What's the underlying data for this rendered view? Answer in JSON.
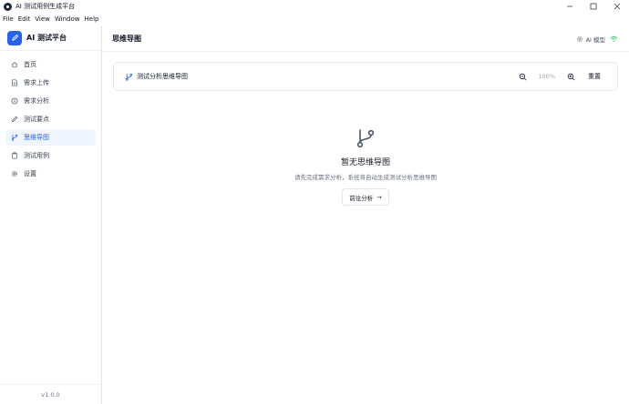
{
  "window": {
    "title": "AI 测试用例生成平台"
  },
  "menu": [
    "File",
    "Edit",
    "View",
    "Window",
    "Help"
  ],
  "brand": {
    "name": "AI 测试平台"
  },
  "sidebar": {
    "items": [
      {
        "label": "首页",
        "icon": "home-icon",
        "active": false
      },
      {
        "label": "需求上传",
        "icon": "file-text-icon",
        "active": false
      },
      {
        "label": "需求分析",
        "icon": "analysis-icon",
        "active": false
      },
      {
        "label": "测试要点",
        "icon": "pencil-icon",
        "active": false
      },
      {
        "label": "思维导图",
        "icon": "git-branch-icon",
        "active": true
      },
      {
        "label": "测试用例",
        "icon": "clipboard-icon",
        "active": false
      },
      {
        "label": "设置",
        "icon": "gear-icon",
        "active": false
      }
    ],
    "version": "v1.0.0"
  },
  "header": {
    "title": "思维导图",
    "model_label": "AI 模型",
    "status_color": "#22c55e"
  },
  "toolbar": {
    "title": "测试分析思维导图",
    "zoom": "100%",
    "reset_label": "重置"
  },
  "empty_state": {
    "title": "暂无思维导图",
    "description": "请先完成需求分析，系统将自动生成测试分析思维导图",
    "button_label": "前往分析",
    "button_arrow": "→"
  },
  "colors": {
    "accent": "#2563eb",
    "active_bg": "#eff6ff"
  }
}
